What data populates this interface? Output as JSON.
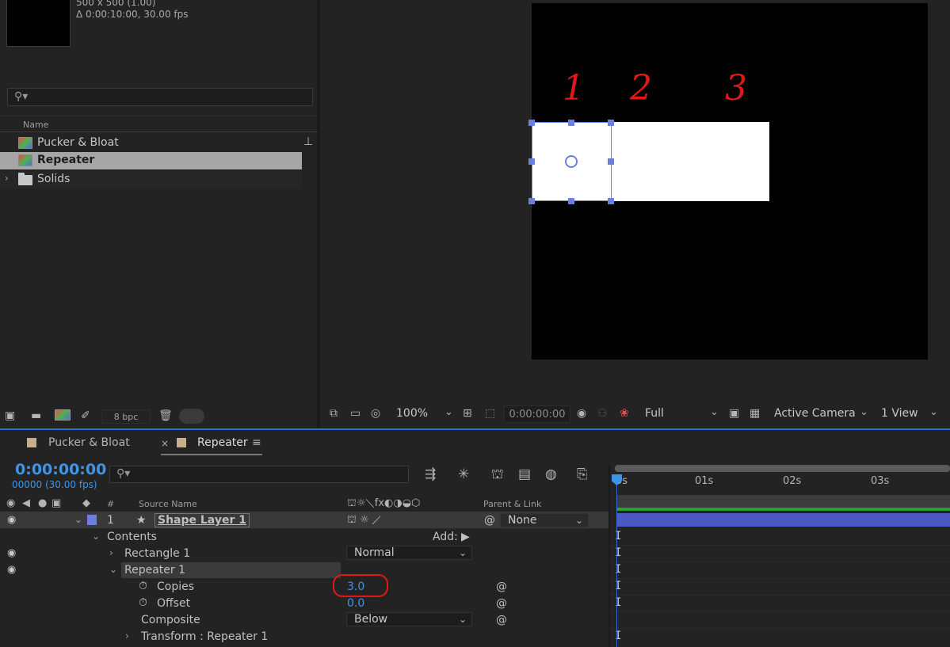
{
  "project_panel": {
    "info_line1": "500 x 500 (1.00)",
    "info_line2": "Δ 0:00:10:00, 30.00 fps",
    "search_placeholder": "",
    "name_header": "Name",
    "items": [
      {
        "label": "Pucker & Bloat",
        "type": "composition",
        "selected": false
      },
      {
        "label": "Repeater",
        "type": "composition",
        "selected": true
      },
      {
        "label": "Solids",
        "type": "folder",
        "selected": false
      }
    ],
    "bit_depth": "8 bpc"
  },
  "viewer": {
    "annotations": [
      "1",
      "2",
      "3"
    ],
    "toolbar": {
      "zoom": "100%",
      "timecode": "0:00:00:00",
      "resolution": "Full",
      "camera": "Active Camera",
      "view_layout": "1 View"
    }
  },
  "timeline": {
    "tabs": [
      {
        "label": "Pucker & Bloat",
        "active": false
      },
      {
        "label": "Repeater",
        "active": true
      }
    ],
    "current_time": "0:00:00:00",
    "frame_info": "00000 (30.00 fps)",
    "columns": {
      "number": "#",
      "source_name": "Source Name",
      "parent_link": "Parent & Link"
    },
    "layer": {
      "number": "1",
      "name": "Shape Layer 1",
      "parent": "None"
    },
    "rows": {
      "contents": "Contents",
      "add_label": "Add:",
      "rectangle": "Rectangle 1",
      "blend_mode": "Normal",
      "repeater": "Repeater 1",
      "copies_label": "Copies",
      "copies_value": "3.0",
      "offset_label": "Offset",
      "offset_value": "0.0",
      "composite_label": "Composite",
      "composite_value": "Below",
      "transform_label": "Transform : Repeater 1"
    },
    "ruler": [
      "0s",
      "01s",
      "02s",
      "03s"
    ],
    "colors": {
      "accent": "#3d95e8",
      "layer_bar": "#4c59c2",
      "tab_label_color": "#c5b089",
      "annotation_red": "#e01818"
    }
  }
}
